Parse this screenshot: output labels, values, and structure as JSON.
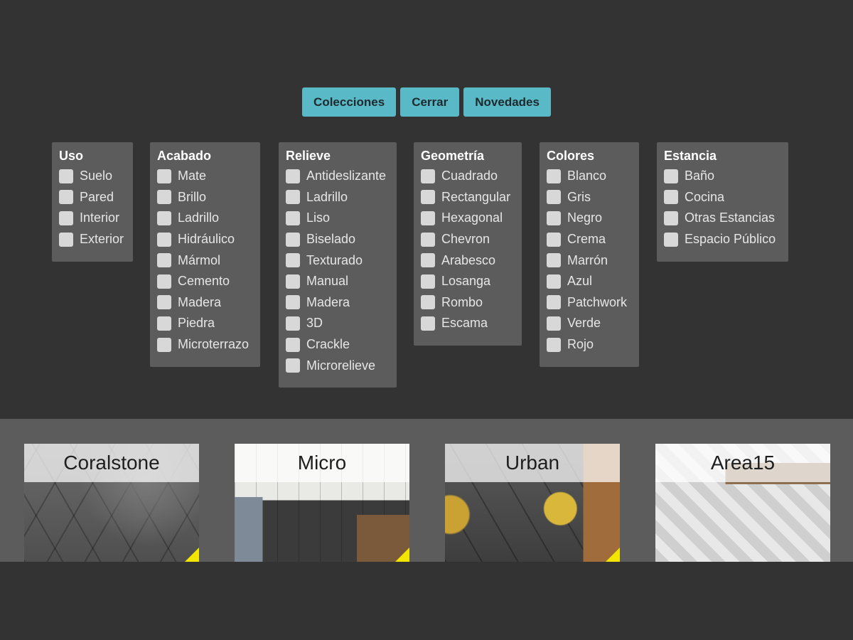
{
  "nav": {
    "buttons": [
      "Colecciones",
      "Cerrar",
      "Novedades"
    ],
    "accent_color": "#5ab9c7"
  },
  "filters": [
    {
      "title": "Uso",
      "options": [
        "Suelo",
        "Pared",
        "Interior",
        "Exterior"
      ]
    },
    {
      "title": "Acabado",
      "options": [
        "Mate",
        "Brillo",
        "Ladrillo",
        "Hidráulico",
        "Mármol",
        "Cemento",
        "Madera",
        "Piedra",
        "Microterrazo"
      ]
    },
    {
      "title": "Relieve",
      "options": [
        "Antideslizante",
        "Ladrillo",
        "Liso",
        "Biselado",
        "Texturado",
        "Manual",
        "Madera",
        "3D",
        "Crackle",
        "Microrelieve"
      ]
    },
    {
      "title": "Geometría",
      "options": [
        "Cuadrado",
        "Rectangular",
        "Hexagonal",
        "Chevron",
        "Arabesco",
        "Losanga",
        "Rombo",
        "Escama"
      ]
    },
    {
      "title": "Colores",
      "options": [
        "Blanco",
        "Gris",
        "Negro",
        "Crema",
        "Marrón",
        "Azul",
        "Patchwork",
        "Verde",
        "Rojo"
      ]
    },
    {
      "title": "Estancia",
      "options": [
        "Baño",
        "Cocina",
        "Otras Estancias",
        "Espacio Público"
      ]
    }
  ],
  "collections": [
    {
      "title": "Coralstone",
      "new_badge": true
    },
    {
      "title": "Micro",
      "new_badge": true
    },
    {
      "title": "Urban",
      "new_badge": true
    },
    {
      "title": "Area15",
      "new_badge": false
    }
  ]
}
